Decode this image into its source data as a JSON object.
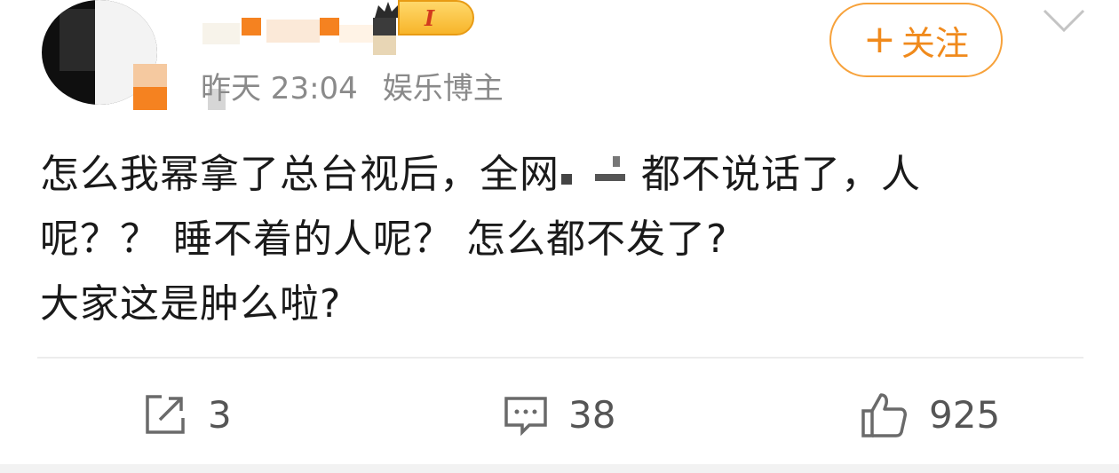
{
  "post": {
    "timestamp": "昨天 23:04",
    "user_tag": "娱乐博主",
    "follow_label": "关注",
    "follow_symbol": "+",
    "vip_level": "I",
    "content_lines": [
      "怎么我幂拿了总台视后，全网",
      "都不说话了，人",
      "呢？？  睡不着的人呢？  怎么都不发了?",
      "大家这是肿么啦?"
    ]
  },
  "actions": {
    "repost": {
      "count": "3",
      "icon": "share-icon"
    },
    "comment": {
      "count": "38",
      "icon": "comment-icon"
    },
    "like": {
      "count": "925",
      "icon": "thumbs-up-icon"
    }
  },
  "colors": {
    "accent": "#f08a1c",
    "follow_border": "#f7a23b",
    "meta_text": "#8a8a8a",
    "body_text": "#1a1a1a"
  }
}
